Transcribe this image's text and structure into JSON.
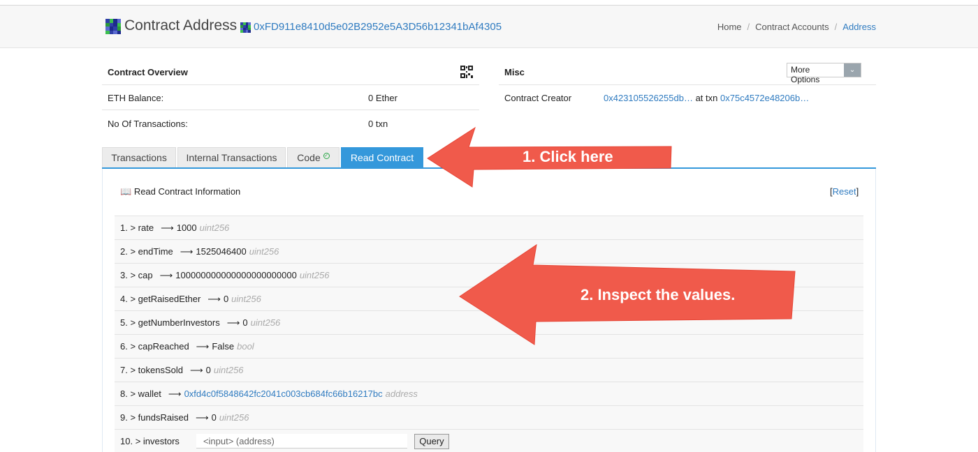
{
  "header": {
    "title": "Contract Address",
    "address": "0xFD911e8410d5e02B2952e5A3D56b12341bAf4305",
    "breadcrumb": [
      "Home",
      "Contract Accounts",
      "Address"
    ]
  },
  "overview": {
    "title": "Contract Overview",
    "rows": [
      {
        "label": "ETH Balance:",
        "value": "0 Ether"
      },
      {
        "label": "No Of Transactions:",
        "value": "0 txn"
      }
    ]
  },
  "misc": {
    "title": "Misc",
    "more_options": "More Options",
    "creator_label": "Contract Creator",
    "creator_address": "0x423105526255db…",
    "at_txn": "at txn",
    "creator_txn": "0x75c4572e48206b…"
  },
  "tabs": [
    "Transactions",
    "Internal Transactions",
    "Code",
    "Read Contract"
  ],
  "read_contract": {
    "title": "Read Contract Information",
    "reset": "Reset",
    "items": [
      {
        "num": "1.",
        "name": "rate",
        "value": "1000",
        "type": "uint256"
      },
      {
        "num": "2.",
        "name": "endTime",
        "value": "1525046400",
        "type": "uint256"
      },
      {
        "num": "3.",
        "name": "cap",
        "value": "100000000000000000000000",
        "type": "uint256"
      },
      {
        "num": "4.",
        "name": "getRaisedEther",
        "value": "0",
        "type": "uint256"
      },
      {
        "num": "5.",
        "name": "getNumberInvestors",
        "value": "0",
        "type": "uint256"
      },
      {
        "num": "6.",
        "name": "capReached",
        "value": "False",
        "type": "bool"
      },
      {
        "num": "7.",
        "name": "tokensSold",
        "value": "0",
        "type": "uint256"
      },
      {
        "num": "8.",
        "name": "wallet",
        "value": "0xfd4c0f5848642fc2041c003cb684fc66b16217bc",
        "type": "address"
      },
      {
        "num": "9.",
        "name": "fundsRaised",
        "value": "0",
        "type": "uint256"
      }
    ],
    "query_item": {
      "num": "10.",
      "name": "investors",
      "placeholder": "<input> (address)",
      "button": "Query"
    }
  },
  "annotations": {
    "arrow1": "1. Click here",
    "arrow2": "2. Inspect the values."
  },
  "colors": {
    "link": "#2f7bc0",
    "tab_active": "#3498db",
    "annotation": "#f05a4b"
  },
  "icons": [
    "identicon",
    "qr-code-icon",
    "book-icon",
    "check-circle-icon",
    "chevron-down-icon",
    "right-arrow-icon"
  ]
}
